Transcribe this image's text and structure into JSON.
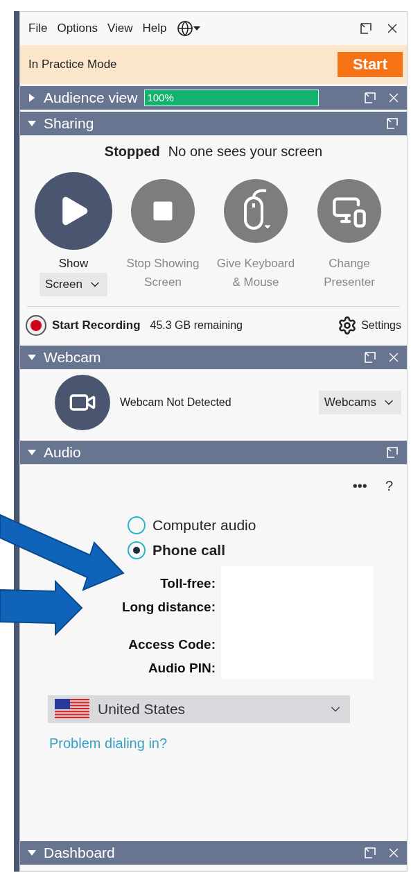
{
  "menu": {
    "items": [
      "File",
      "Options",
      "View",
      "Help"
    ]
  },
  "practice": {
    "label": "In Practice Mode",
    "button": "Start"
  },
  "audience_view": {
    "title": "Audience view",
    "expanded": false,
    "closable": true,
    "reading": "100%",
    "level": 1
  },
  "sharing": {
    "title": "Sharing",
    "expanded": true,
    "closable": false,
    "status": "Stopped",
    "message": "No one sees your screen",
    "actions": [
      {
        "kind": "play",
        "label": "Show",
        "dropdown": "Screen",
        "disabled": false
      },
      {
        "kind": "stop",
        "label": "Stop Showing Screen",
        "disabled": true
      },
      {
        "kind": "mouse",
        "label": "Give Keyboard & Mouse",
        "disabled": true
      },
      {
        "kind": "monitor",
        "label": "Change Presenter",
        "disabled": true
      }
    ],
    "recording": {
      "label": "Start Recording",
      "remaining": "45.3 GB remaining",
      "settings": "Settings"
    }
  },
  "webcam": {
    "title": "Webcam",
    "expanded": true,
    "closable": true,
    "status": "Webcam Not Detected",
    "dropdown": "Webcams"
  },
  "audio": {
    "title": "Audio",
    "expanded": true,
    "closable": false,
    "more": "•••",
    "help": "?",
    "options": [
      {
        "label": "Computer audio",
        "selected": false
      },
      {
        "label": "Phone call",
        "selected": true
      }
    ],
    "fields": [
      "Toll-free:",
      "Long distance:",
      "Access Code:",
      "Audio PIN:"
    ],
    "country": "United States",
    "link": "Problem dialing in?"
  },
  "dashboard": {
    "title": "Dashboard",
    "expanded": true,
    "closable": true
  }
}
